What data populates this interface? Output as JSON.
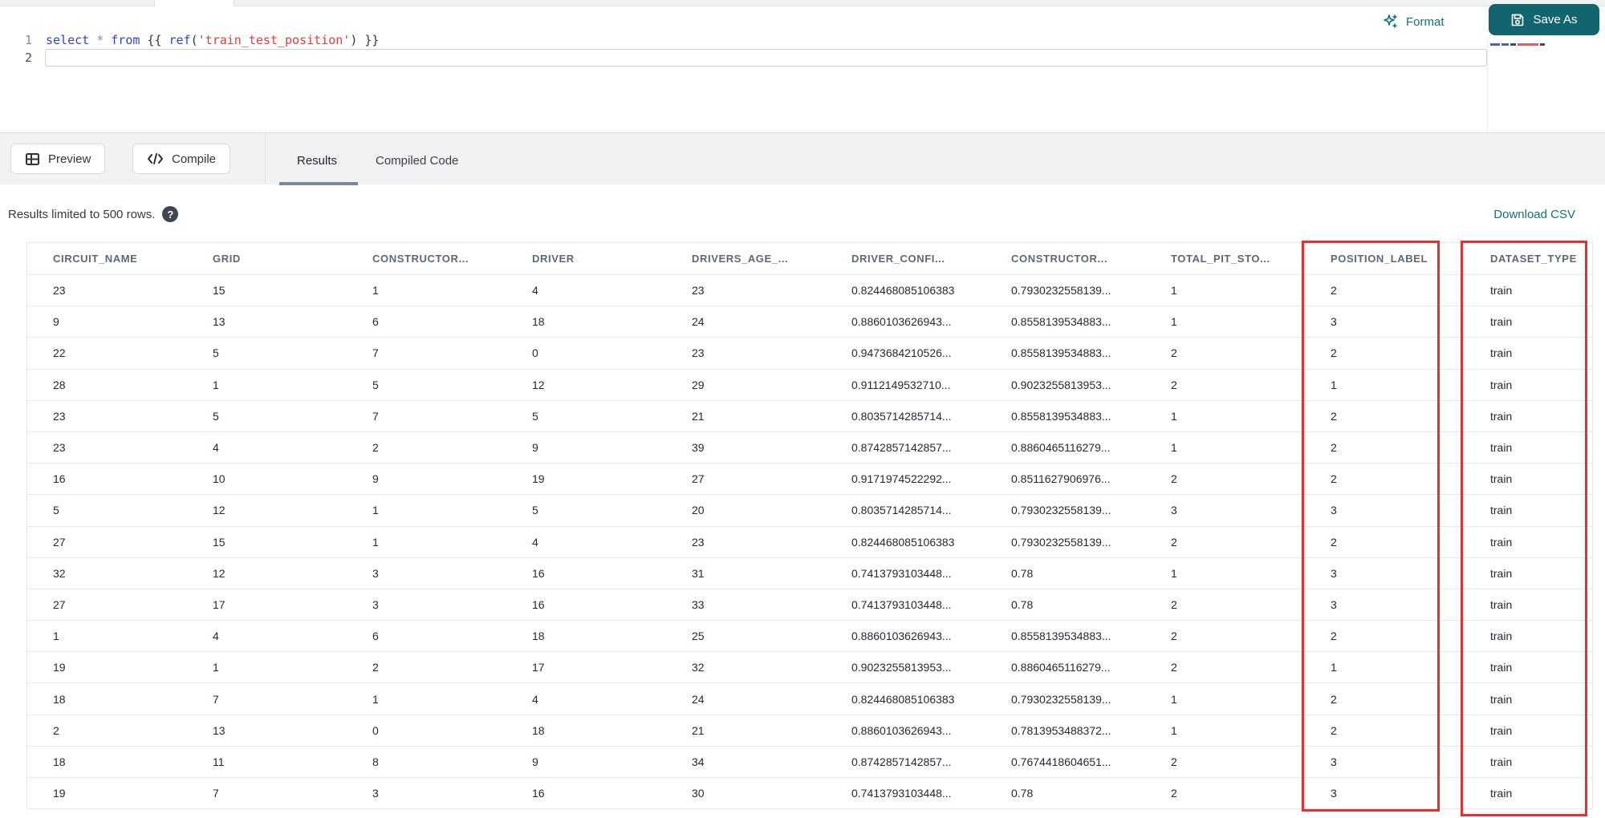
{
  "colors": {
    "accent_teal": "#13717A",
    "button_teal": "#12656F",
    "annotation_red": "#EC2D30"
  },
  "editor": {
    "line1_number": "1",
    "line2_number": "2",
    "code_plain": "select * from {{ ref('train_test_position') }}",
    "tokens": [
      {
        "text": "select",
        "type": "kw"
      },
      {
        "text": " ",
        "type": "plain"
      },
      {
        "text": "*",
        "type": "op"
      },
      {
        "text": " ",
        "type": "plain"
      },
      {
        "text": "from",
        "type": "kw"
      },
      {
        "text": " {{ ",
        "type": "brace"
      },
      {
        "text": "ref",
        "type": "fn"
      },
      {
        "text": "(",
        "type": "brace"
      },
      {
        "text": "'train_test_position'",
        "type": "str"
      },
      {
        "text": ")",
        "type": "brace"
      },
      {
        "text": " }}",
        "type": "brace"
      }
    ]
  },
  "actions": {
    "format_label": "Format",
    "save_as_label": "Save As"
  },
  "toolbar": {
    "preview_label": "Preview",
    "compile_label": "Compile"
  },
  "tabs": [
    {
      "label": "Results",
      "active": true
    },
    {
      "label": "Compiled Code",
      "active": false
    }
  ],
  "results": {
    "note": "Results limited to 500 rows.",
    "help_icon_glyph": "?",
    "download_label": "Download CSV",
    "table": {
      "columns": [
        "CIRCUIT_NAME",
        "GRID",
        "CONSTRUCTOR...",
        "DRIVER",
        "DRIVERS_AGE_...",
        "DRIVER_CONFI...",
        "CONSTRUCTOR...",
        "TOTAL_PIT_STO...",
        "POSITION_LABEL",
        "DATASET_TYPE"
      ],
      "annotated_columns": [
        "POSITION_LABEL",
        "DATASET_TYPE"
      ],
      "rows": [
        [
          "23",
          "15",
          "1",
          "4",
          "23",
          "0.824468085106383",
          "0.7930232558139...",
          "1",
          "2",
          "train"
        ],
        [
          "9",
          "13",
          "6",
          "18",
          "24",
          "0.8860103626943...",
          "0.8558139534883...",
          "1",
          "3",
          "train"
        ],
        [
          "22",
          "5",
          "7",
          "0",
          "23",
          "0.9473684210526...",
          "0.8558139534883...",
          "2",
          "2",
          "train"
        ],
        [
          "28",
          "1",
          "5",
          "12",
          "29",
          "0.9112149532710...",
          "0.9023255813953...",
          "2",
          "1",
          "train"
        ],
        [
          "23",
          "5",
          "7",
          "5",
          "21",
          "0.8035714285714...",
          "0.8558139534883...",
          "1",
          "2",
          "train"
        ],
        [
          "23",
          "4",
          "2",
          "9",
          "39",
          "0.8742857142857...",
          "0.8860465116279...",
          "1",
          "2",
          "train"
        ],
        [
          "16",
          "10",
          "9",
          "19",
          "27",
          "0.9171974522292...",
          "0.8511627906976...",
          "2",
          "2",
          "train"
        ],
        [
          "5",
          "12",
          "1",
          "5",
          "20",
          "0.8035714285714...",
          "0.7930232558139...",
          "3",
          "3",
          "train"
        ],
        [
          "27",
          "15",
          "1",
          "4",
          "23",
          "0.824468085106383",
          "0.7930232558139...",
          "2",
          "2",
          "train"
        ],
        [
          "32",
          "12",
          "3",
          "16",
          "31",
          "0.7413793103448...",
          "0.78",
          "1",
          "3",
          "train"
        ],
        [
          "27",
          "17",
          "3",
          "16",
          "33",
          "0.7413793103448...",
          "0.78",
          "2",
          "3",
          "train"
        ],
        [
          "1",
          "4",
          "6",
          "18",
          "25",
          "0.8860103626943...",
          "0.8558139534883...",
          "2",
          "2",
          "train"
        ],
        [
          "19",
          "1",
          "2",
          "17",
          "32",
          "0.9023255813953...",
          "0.8860465116279...",
          "2",
          "1",
          "train"
        ],
        [
          "18",
          "7",
          "1",
          "4",
          "24",
          "0.824468085106383",
          "0.7930232558139...",
          "1",
          "2",
          "train"
        ],
        [
          "2",
          "13",
          "0",
          "18",
          "21",
          "0.8860103626943...",
          "0.7813953488372...",
          "1",
          "2",
          "train"
        ],
        [
          "18",
          "11",
          "8",
          "9",
          "34",
          "0.8742857142857...",
          "0.7674418604651...",
          "2",
          "3",
          "train"
        ],
        [
          "19",
          "7",
          "3",
          "16",
          "30",
          "0.7413793103448...",
          "0.78",
          "2",
          "3",
          "train"
        ]
      ]
    }
  }
}
